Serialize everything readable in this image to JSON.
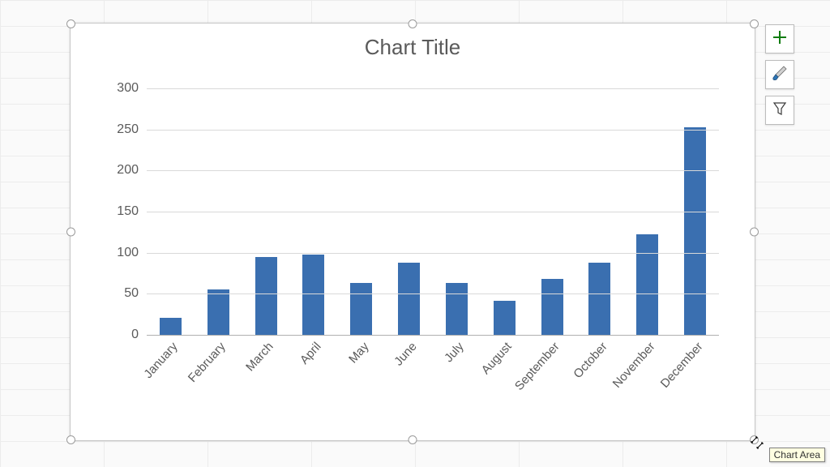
{
  "chart_data": {
    "type": "bar",
    "title": "Chart Title",
    "categories": [
      "January",
      "February",
      "March",
      "April",
      "May",
      "June",
      "July",
      "August",
      "September",
      "October",
      "November",
      "December"
    ],
    "values": [
      21,
      55,
      95,
      98,
      63,
      88,
      63,
      41,
      68,
      88,
      122,
      253
    ],
    "xlabel": "",
    "ylabel": "",
    "ylim": [
      0,
      300
    ],
    "yticks": [
      0,
      50,
      100,
      150,
      200,
      250,
      300
    ],
    "grid": true,
    "bar_color": "#3a6fb0"
  },
  "side_buttons": {
    "elements_label": "Chart Elements",
    "styles_label": "Chart Styles",
    "filters_label": "Chart Filters"
  },
  "tooltip_text": "Chart Area"
}
